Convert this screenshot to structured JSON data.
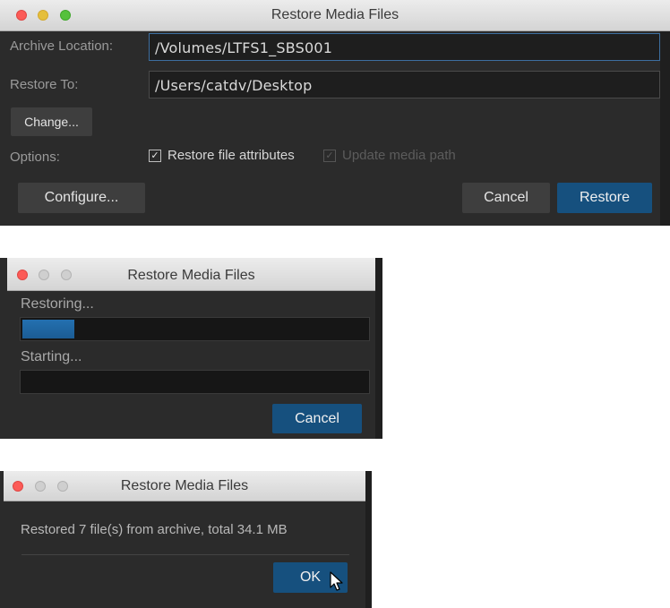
{
  "dialog1": {
    "title": "Restore Media Files",
    "archive_location_label": "Archive Location:",
    "archive_location_value": "/Volumes/LTFS1_SBS001",
    "restore_to_label": "Restore To:",
    "restore_to_value": "/Users/catdv/Desktop",
    "change_button": "Change...",
    "options_label": "Options:",
    "restore_file_attributes": {
      "label": "Restore file attributes",
      "checked": true
    },
    "update_media_path": {
      "label": "Update media path",
      "checked": true,
      "enabled": false
    },
    "configure_button": "Configure...",
    "cancel_button": "Cancel",
    "restore_button": "Restore"
  },
  "dialog2": {
    "title": "Restore Media Files",
    "restoring_label": "Restoring...",
    "restoring_progress": 0.15,
    "starting_label": "Starting...",
    "starting_progress": 0,
    "cancel_button": "Cancel"
  },
  "dialog3": {
    "title": "Restore Media Files",
    "message": "Restored 7 file(s) from archive, total 34.1 MB",
    "ok_button": "OK"
  },
  "colors": {
    "window_bg": "#2b2b2b",
    "primary_button": "#16507e",
    "progress_fill": "#1f64a0"
  }
}
